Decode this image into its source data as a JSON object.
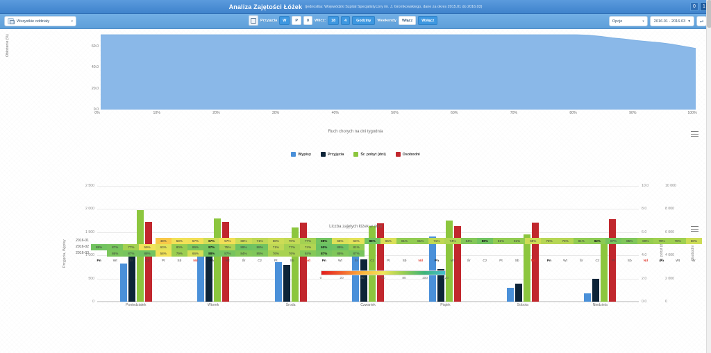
{
  "window": {
    "title": "Analiza Zajętości Łóżek",
    "subtitle": "(jednostka: Wojewódzki Szpital Specjalistyczny im. J. Gromkowskiego, dane za okres 2015.01 do 2016.03)",
    "minimize_label": "0",
    "restore_label": "1"
  },
  "toolbar": {
    "unit_select": {
      "icon": "building-icon",
      "value": "Wszystkie oddziały",
      "caret": "▾"
    },
    "grid_button": "grid-icon",
    "admissions_label": "Przyjęcia",
    "admissions_options": [
      "W",
      "P",
      "0"
    ],
    "discharge_label": "Wlicz:",
    "discharge_options": [
      "18",
      "4",
      "Godziny"
    ],
    "weekend_label": "Weekendy",
    "weekend_options": [
      "Włącz",
      "Wyłącz"
    ],
    "options_select": {
      "value": "Opcje",
      "caret": "▾"
    },
    "date_range": {
      "value": "2016.01 - 2016.03",
      "caret": "▾"
    },
    "refresh_icon": "refresh-icon"
  },
  "chart_data": [
    {
      "type": "area",
      "title": "",
      "ylabel": "Obłożenie (%)",
      "xlabel": "",
      "ylim": [
        0,
        75
      ],
      "yticks": [
        0.0,
        20.0,
        40.0,
        60.0
      ],
      "ytick_labels": [
        "0.0",
        "20.0",
        "40.0",
        "60.0"
      ],
      "xticks": [
        0,
        10,
        20,
        30,
        40,
        50,
        60,
        70,
        80,
        90,
        100
      ],
      "xtick_labels": [
        "0%",
        "10%",
        "20%",
        "30%",
        "40%",
        "50%",
        "60%",
        "70%",
        "80%",
        "90%",
        "100%"
      ],
      "color": "#8ab8e8",
      "grid": false,
      "x": [
        0,
        5,
        10,
        15,
        20,
        25,
        30,
        35,
        40,
        45,
        50,
        55,
        60,
        65,
        70,
        75,
        80,
        82,
        84,
        86,
        88,
        90,
        92,
        94,
        96,
        98,
        100
      ],
      "values": [
        71,
        71,
        71,
        71,
        71,
        71,
        71,
        71,
        71,
        71,
        71,
        71,
        71,
        71,
        71,
        71,
        71,
        70.5,
        69.5,
        68,
        67,
        65.5,
        64.5,
        63.5,
        62,
        60,
        58
      ]
    },
    {
      "type": "bar",
      "title": "Ruch chorych na dni tygodnia",
      "categories": [
        "Poniedziałek",
        "Wtorek",
        "Środa",
        "Czwartek",
        "Piątek",
        "Sobota",
        "Niedziela"
      ],
      "ylabel_left": "Przyjęcia, Wypisy",
      "ylabel_right1": "Śr. pobyt (dni)",
      "ylabel_right2": "Osobodni",
      "ylim_left": [
        0,
        2500
      ],
      "yticks_left": [
        0,
        500,
        1000,
        1500,
        2000,
        2500
      ],
      "ytick_labels_left": [
        "0",
        "500",
        "1 000",
        "1 500",
        "2 000",
        "2 500"
      ],
      "ylim_right1": [
        0,
        10
      ],
      "yticks_right1": [
        0.0,
        2.0,
        4.0,
        6.0,
        8.0,
        10.0
      ],
      "ytick_labels_right1": [
        "0.0",
        "2.0",
        "4.0",
        "6.0",
        "8.0",
        "10.0"
      ],
      "ylim_right2": [
        0,
        10000
      ],
      "yticks_right2": [
        0,
        2000,
        4000,
        6000,
        8000,
        10000
      ],
      "ytick_labels_right2": [
        "0",
        "2 000",
        "4 000",
        "6 000",
        "8 000",
        "10 000"
      ],
      "series": [
        {
          "name": "Wypisy",
          "color": "#4a90d9",
          "axis": "left",
          "values": [
            820,
            990,
            860,
            1000,
            1400,
            300,
            175
          ]
        },
        {
          "name": "Przyjęcia",
          "color": "#0d2438",
          "axis": "left",
          "values": [
            1060,
            980,
            800,
            920,
            700,
            390,
            500
          ]
        },
        {
          "name": "Śr. pobyt (dni)",
          "color": "#8cc63e",
          "axis": "right1",
          "values": [
            7.9,
            7.2,
            6.4,
            6.5,
            7.0,
            5.8,
            5.5
          ]
        },
        {
          "name": "Osobodni",
          "color": "#c1272d",
          "axis": "right2",
          "values": [
            6900,
            6900,
            6850,
            6750,
            6500,
            6850,
            7100
          ]
        }
      ]
    },
    {
      "type": "heatmap",
      "title": "Liczba zajętych łóżek w dniu",
      "row_labels": [
        "2016-01",
        "2016-02",
        "2016-03"
      ],
      "day_labels": [
        "Pn",
        "Wt",
        "Śr",
        "Cz",
        "Pt",
        "Sb",
        "Nd"
      ],
      "colorbar": {
        "ticks": [
          0,
          20,
          40,
          60,
          80,
          100,
          120
        ],
        "tick_labels": [
          "0",
          "20",
          "40",
          "60",
          "80",
          "100",
          "120"
        ]
      },
      "rows": [
        [
          null,
          null,
          null,
          null,
          "48%",
          "58%",
          "57%",
          "67%",
          "57%",
          "68%",
          "71%",
          "68%",
          "70%",
          "77%",
          "88%",
          "65%",
          "63%",
          "88%",
          "65%",
          "81%",
          "81%",
          "71%",
          "74%",
          "84%",
          "88%",
          "81%",
          "81%",
          "68%",
          "73%",
          "73%",
          "81%",
          "82%",
          "87%",
          "85%",
          "80%",
          "78%",
          "78%",
          "68%"
        ],
        [
          "88%",
          "87%",
          "77%",
          "59%",
          "63%",
          "80%",
          "86%",
          "87%",
          "75%",
          "89%",
          "88%",
          "71%",
          "77%",
          "74%",
          "90%",
          "89%",
          "81%",
          null,
          null,
          null,
          null,
          null,
          null,
          null,
          null,
          null,
          null,
          null,
          null,
          null,
          null,
          null,
          null,
          null,
          null,
          null,
          null,
          null
        ],
        [
          null,
          "86%",
          "87%",
          "88%",
          "58%",
          "79%",
          "66%",
          "88%",
          "87%",
          "84%",
          "85%",
          "76%",
          "76%",
          "84%",
          "87%",
          "85%",
          "87%",
          null,
          null,
          null,
          null,
          null,
          null,
          null,
          null,
          null,
          null,
          null,
          null,
          null,
          null,
          null,
          null,
          null,
          null,
          null,
          null,
          null
        ]
      ],
      "row_values": [
        [
          null,
          null,
          null,
          null,
          48,
          58,
          57,
          67,
          57,
          68,
          71,
          68,
          70,
          77,
          88,
          65,
          63,
          88,
          65,
          81,
          81,
          71,
          74,
          84,
          88,
          81,
          81,
          68,
          73,
          73,
          81,
          82,
          87,
          85,
          80,
          78,
          78,
          68
        ],
        [
          88,
          87,
          77,
          59,
          63,
          80,
          86,
          87,
          75,
          89,
          88,
          71,
          77,
          74,
          90,
          89,
          81,
          null,
          null,
          null,
          null,
          null,
          null,
          null,
          null,
          null,
          null,
          null,
          null,
          null,
          null,
          null,
          null,
          null,
          null,
          null,
          null,
          null
        ],
        [
          null,
          86,
          87,
          88,
          58,
          79,
          66,
          88,
          87,
          84,
          85,
          76,
          76,
          84,
          87,
          85,
          87,
          null,
          null,
          null,
          null,
          null,
          null,
          null,
          null,
          null,
          null,
          null,
          null,
          null,
          null,
          null,
          null,
          null,
          null,
          null,
          null,
          null
        ]
      ],
      "bold_indices": [
        7,
        14,
        17,
        24,
        31
      ],
      "menu_icon": "hamburger-icon"
    }
  ]
}
